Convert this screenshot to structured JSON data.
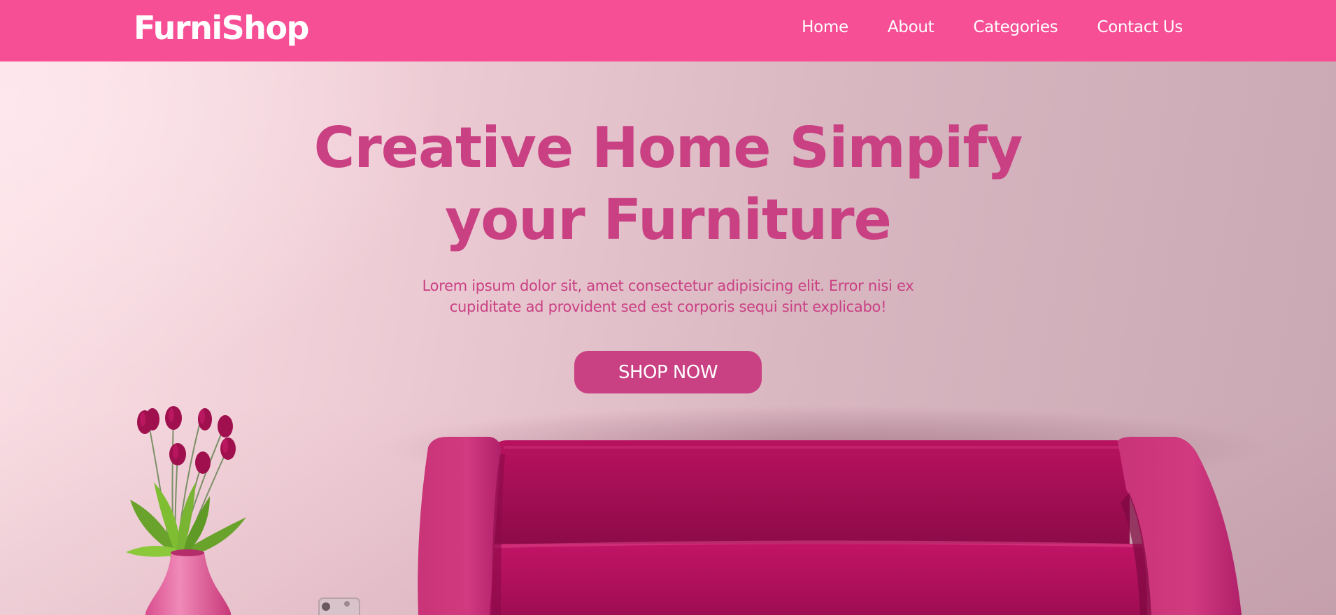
{
  "header": {
    "logo": "FurniShop",
    "nav": [
      {
        "label": "Home"
      },
      {
        "label": "About"
      },
      {
        "label": "Categories"
      },
      {
        "label": "Contact Us"
      }
    ]
  },
  "hero": {
    "title": "Creative Home Simpify your Furniture",
    "description": "Lorem ipsum dolor sit, amet consectetur adipisicing elit. Error nisi ex cupiditate ad provident sed est corporis sequi sint explicabo!",
    "cta_label": "SHOP NOW"
  },
  "colors": {
    "nav_bg": "#f74f96",
    "accent": "#c94083",
    "sofa": "#c21466",
    "background": "#efcdd6"
  },
  "icons": [
    "tulip-vase-image",
    "pink-sofa-image",
    "small-clock-image"
  ]
}
